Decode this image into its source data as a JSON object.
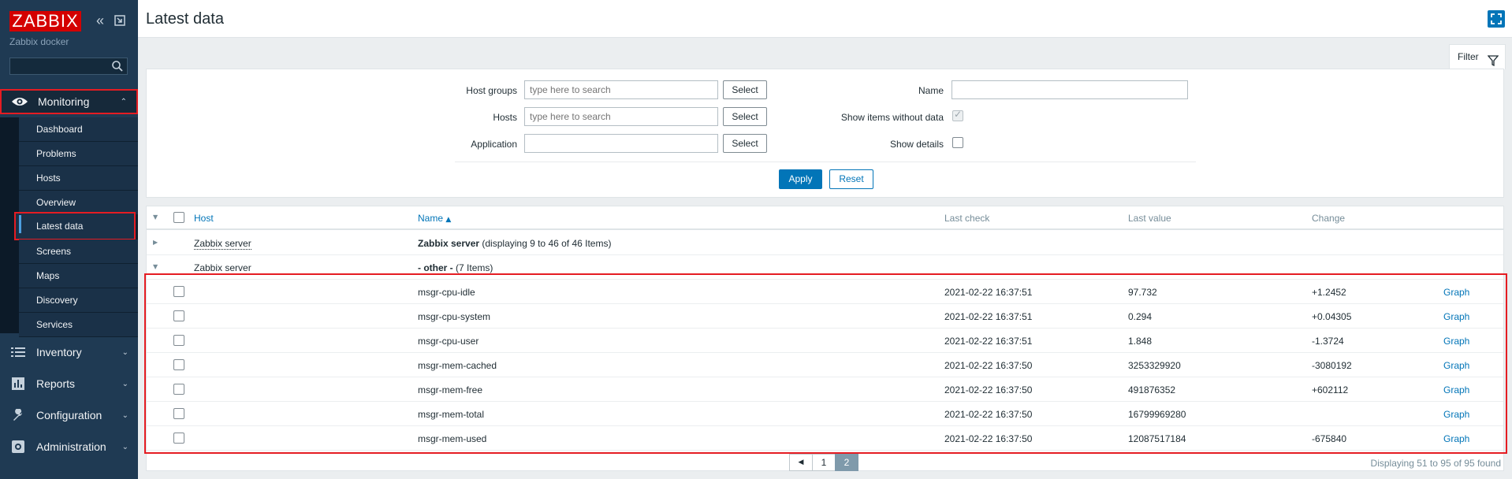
{
  "app": {
    "logo_text": "ZABBIX",
    "subtitle": "Zabbix docker"
  },
  "sidebar": {
    "search": {
      "value": "",
      "placeholder": ""
    },
    "menu": [
      {
        "label": "Monitoring",
        "icon": "eye-icon",
        "expanded": true,
        "active": true
      },
      {
        "label": "Inventory",
        "icon": "list-icon",
        "expanded": false
      },
      {
        "label": "Reports",
        "icon": "bar-chart-icon",
        "expanded": false
      },
      {
        "label": "Configuration",
        "icon": "wrench-icon",
        "expanded": false
      },
      {
        "label": "Administration",
        "icon": "gear-icon",
        "expanded": false
      }
    ],
    "submenu": [
      {
        "label": "Dashboard"
      },
      {
        "label": "Problems"
      },
      {
        "label": "Hosts"
      },
      {
        "label": "Overview"
      },
      {
        "label": "Latest data",
        "active": true
      },
      {
        "label": "Screens"
      },
      {
        "label": "Maps"
      },
      {
        "label": "Discovery"
      },
      {
        "label": "Services"
      }
    ]
  },
  "header": {
    "title": "Latest data"
  },
  "filter": {
    "tab_label": "Filter",
    "host_groups": {
      "label": "Host groups",
      "placeholder": "type here to search",
      "button": "Select"
    },
    "hosts": {
      "label": "Hosts",
      "placeholder": "type here to search",
      "button": "Select"
    },
    "application": {
      "label": "Application",
      "value": "",
      "button": "Select"
    },
    "name": {
      "label": "Name",
      "value": ""
    },
    "show_without_data": {
      "label": "Show items without data",
      "checked": true,
      "disabled": true
    },
    "show_details": {
      "label": "Show details",
      "checked": false
    },
    "apply_label": "Apply",
    "reset_label": "Reset"
  },
  "table": {
    "headers": {
      "host": "Host",
      "name": "Name",
      "name_sort": "▲",
      "last_check": "Last check",
      "last_value": "Last value",
      "change": "Change"
    },
    "groups": [
      {
        "toggle": "▶",
        "host": "Zabbix server",
        "title": "Zabbix server",
        "info": "(displaying 9 to 46 of 46 Items)"
      },
      {
        "toggle": "▼",
        "host": "Zabbix server",
        "title": "- other -",
        "info": "(7 Items)"
      }
    ],
    "rows": [
      {
        "name": "msgr-cpu-idle",
        "last_check": "2021-02-22 16:37:51",
        "last_value": "97.732",
        "change": "+1.2452",
        "action": "Graph"
      },
      {
        "name": "msgr-cpu-system",
        "last_check": "2021-02-22 16:37:51",
        "last_value": "0.294",
        "change": "+0.04305",
        "action": "Graph"
      },
      {
        "name": "msgr-cpu-user",
        "last_check": "2021-02-22 16:37:51",
        "last_value": "1.848",
        "change": "-1.3724",
        "action": "Graph"
      },
      {
        "name": "msgr-mem-cached",
        "last_check": "2021-02-22 16:37:50",
        "last_value": "3253329920",
        "change": "-3080192",
        "action": "Graph"
      },
      {
        "name": "msgr-mem-free",
        "last_check": "2021-02-22 16:37:50",
        "last_value": "491876352",
        "change": "+602112",
        "action": "Graph"
      },
      {
        "name": "msgr-mem-total",
        "last_check": "2021-02-22 16:37:50",
        "last_value": "16799969280",
        "change": "",
        "action": "Graph"
      },
      {
        "name": "msgr-mem-used",
        "last_check": "2021-02-22 16:37:50",
        "last_value": "12087517184",
        "change": "-675840",
        "action": "Graph"
      }
    ]
  },
  "pagination": {
    "prev": "◀",
    "pages": [
      "1",
      "2"
    ],
    "current": "2",
    "summary": "Displaying 51 to 95 of 95 found"
  },
  "colors": {
    "sidebar_bg": "#1f3a53",
    "accent": "#0275b8",
    "highlight": "#e51c22",
    "logo": "#d40000"
  }
}
